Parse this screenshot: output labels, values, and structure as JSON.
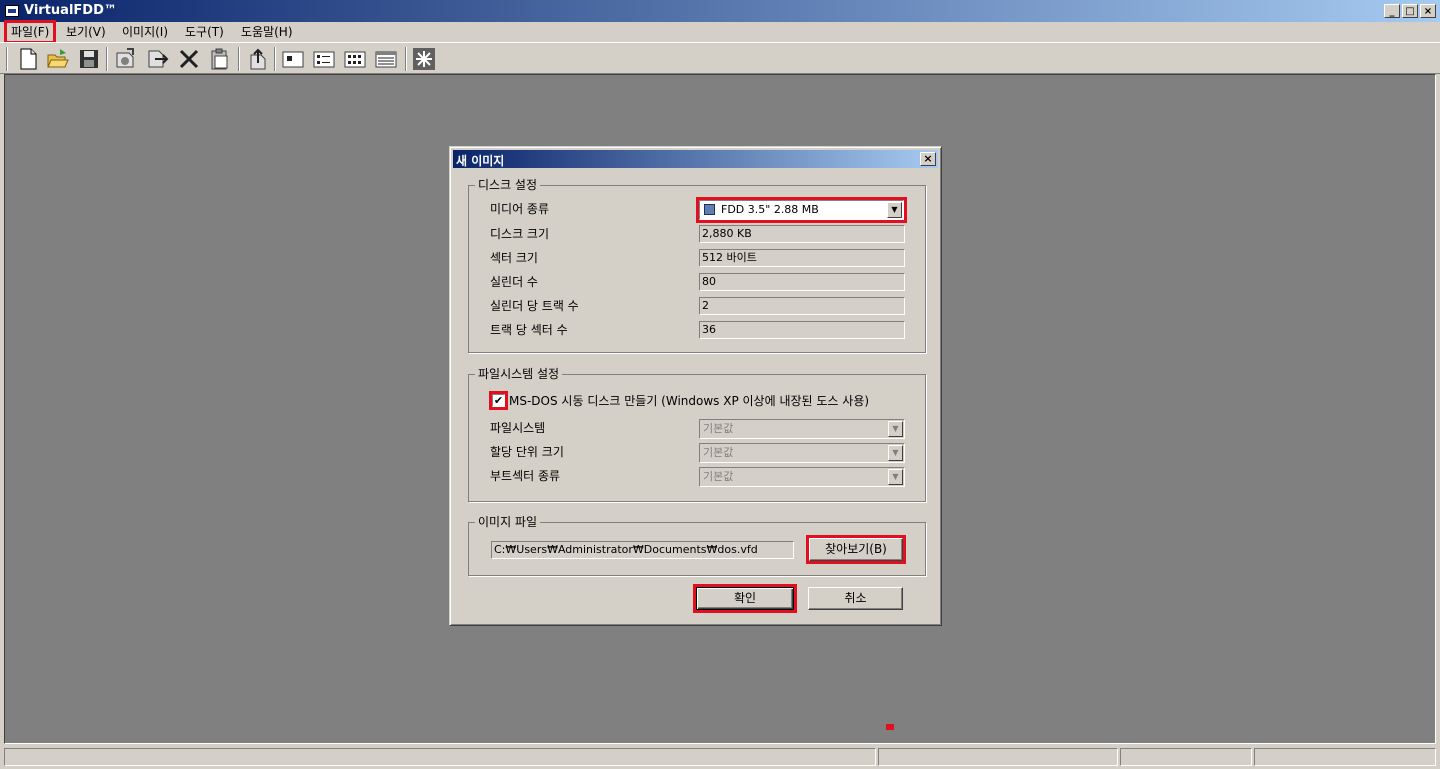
{
  "window": {
    "title": "VirtualFDD™",
    "minimize": "_",
    "maximize": "□",
    "close": "×"
  },
  "menu": [
    {
      "label": "파일(F)"
    },
    {
      "label": "보기(V)"
    },
    {
      "label": "이미지(I)"
    },
    {
      "label": "도구(T)"
    },
    {
      "label": "도움말(H)"
    }
  ],
  "toolbar": {
    "icons": [
      "new-file-icon",
      "open-folder-icon",
      "save-icon",
      "mount-icon",
      "export-icon",
      "delete-icon",
      "paste-icon",
      "upload-icon",
      "large-icons-view-icon",
      "small-icons-view-icon",
      "list-view-icon",
      "details-view-icon",
      "settings-burst-icon"
    ]
  },
  "dialog": {
    "title": "새 이미지",
    "close": "×",
    "disk_settings": {
      "group_label": "디스크 설정",
      "media_type_label": "미디어 종류",
      "media_type_value": "FDD 3.5\" 2.88 MB",
      "disk_size_label": "디스크 크기",
      "disk_size_value": "2,880 KB",
      "sector_size_label": "섹터 크기",
      "sector_size_value": "512 바이트",
      "cylinders_label": "실린더 수",
      "cylinders_value": "80",
      "tracks_per_cylinder_label": "실린더 당 트랙 수",
      "tracks_per_cylinder_value": "2",
      "sectors_per_track_label": "트랙 당 섹터 수",
      "sectors_per_track_value": "36"
    },
    "filesystem_settings": {
      "group_label": "파일시스템 설정",
      "msdos_checkbox_label": "MS-DOS 시동 디스크 만들기 (Windows XP 이상에 내장된 도스 사용)",
      "msdos_checked": "✔",
      "filesystem_label": "파일시스템",
      "filesystem_value": "기본값",
      "allocation_unit_label": "할당 단위 크기",
      "allocation_unit_value": "기본값",
      "boot_sector_label": "부트섹터 종류",
      "boot_sector_value": "기본값"
    },
    "image_file": {
      "group_label": "이미지 파일",
      "path_value": "C:₩Users₩Administrator₩Documents₩dos.vfd",
      "browse_label": "찾아보기(B)"
    },
    "ok_label": "확인",
    "cancel_label": "취소"
  },
  "colors": {
    "highlight": "#e01020",
    "titlebar_start": "#0a246a",
    "titlebar_end": "#a6caf0",
    "workspace": "#808080",
    "chrome": "#d4d0c8"
  }
}
